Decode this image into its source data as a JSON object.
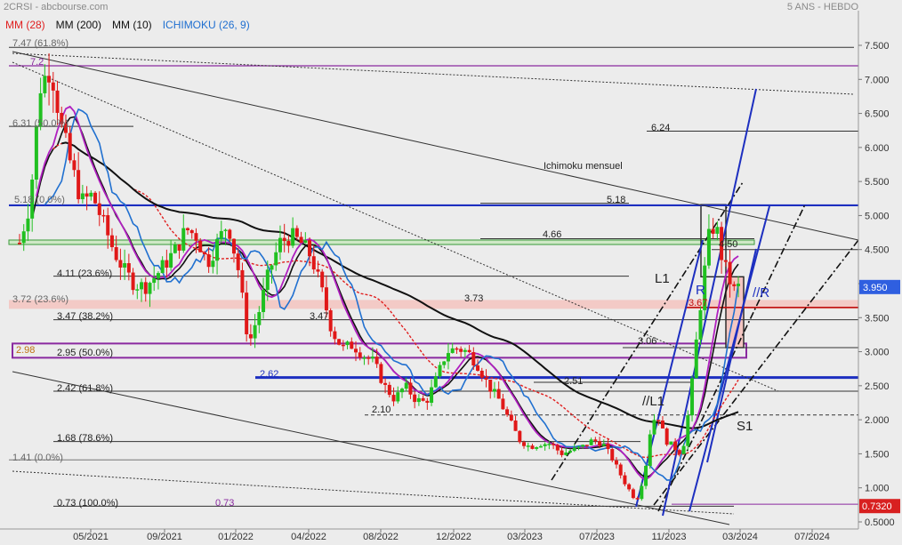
{
  "header": {
    "source": "2CRSI - abcbourse.com",
    "period": "5 ANS - HEBDO"
  },
  "legend": [
    {
      "label": "MM (28)",
      "color": "#e02020"
    },
    {
      "label": "MM (200)",
      "color": "#111111"
    },
    {
      "label": "MM (10)",
      "color": "#111111"
    },
    {
      "label": "ICHIMOKU (26, 9)",
      "color": "#1f6fd0"
    }
  ],
  "chart_data": {
    "type": "candlestick",
    "title": "",
    "y_ticks": [
      "7.500",
      "7.000",
      "6.500",
      "6.000",
      "5.500",
      "5.000",
      "4.500",
      "4.000",
      "3.500",
      "3.000",
      "2.500",
      "2.000",
      "1.500",
      "1.000",
      "0.5000"
    ],
    "x_ticks": [
      "05/2021",
      "09/2021",
      "01/2022",
      "04/2022",
      "08/2022",
      "12/2022",
      "03/2023",
      "07/2023",
      "11/2023",
      "03/2024",
      "07/2024"
    ],
    "ylim": [
      0.44,
      7.69
    ],
    "last_price": "3.950",
    "low_marker": "0.7320",
    "price_path": [
      [
        0,
        4.6
      ],
      [
        0.5,
        5.2
      ],
      [
        1,
        6.9
      ],
      [
        1.5,
        7.2
      ],
      [
        2,
        6.3
      ],
      [
        2.5,
        5.7
      ],
      [
        3,
        5.2
      ],
      [
        3.5,
        5.3
      ],
      [
        4,
        4.9
      ],
      [
        4.5,
        4.5
      ],
      [
        5,
        4.2
      ],
      [
        5.5,
        4.0
      ],
      [
        6,
        3.95
      ],
      [
        6.5,
        4.1
      ],
      [
        7,
        4.3
      ],
      [
        7.5,
        4.5
      ],
      [
        8,
        4.8
      ],
      [
        8.5,
        4.7
      ],
      [
        9,
        4.3
      ],
      [
        9.5,
        4.6
      ],
      [
        10,
        4.9
      ],
      [
        10.5,
        4.2
      ],
      [
        11,
        3.1
      ],
      [
        11.5,
        3.6
      ],
      [
        12,
        4.2
      ],
      [
        12.5,
        4.6
      ],
      [
        13,
        4.7
      ],
      [
        13.5,
        4.6
      ],
      [
        14,
        4.4
      ],
      [
        14.5,
        3.9
      ],
      [
        15,
        3.3
      ],
      [
        15.5,
        3.05
      ],
      [
        16,
        3.1
      ],
      [
        16.5,
        2.95
      ],
      [
        17,
        2.85
      ],
      [
        17.5,
        2.5
      ],
      [
        18,
        2.3
      ],
      [
        18.5,
        2.5
      ],
      [
        19,
        2.3
      ],
      [
        19.5,
        2.25
      ],
      [
        20,
        2.6
      ],
      [
        20.5,
        3.0
      ],
      [
        21,
        3.05
      ],
      [
        21.5,
        3.0
      ],
      [
        22,
        2.8
      ],
      [
        22.5,
        2.5
      ],
      [
        23,
        2.3
      ],
      [
        23.5,
        2.0
      ],
      [
        24,
        1.7
      ],
      [
        24.5,
        1.6
      ],
      [
        25,
        1.65
      ],
      [
        25.5,
        1.65
      ],
      [
        26,
        1.5
      ],
      [
        26.5,
        1.55
      ],
      [
        27,
        1.6
      ],
      [
        27.5,
        1.7
      ],
      [
        28,
        1.65
      ],
      [
        28.5,
        1.4
      ],
      [
        29,
        1.1
      ],
      [
        29.3,
        0.95
      ],
      [
        29.6,
        0.8
      ],
      [
        30,
        1.2
      ],
      [
        30.3,
        1.9
      ],
      [
        30.6,
        2.1
      ],
      [
        31,
        1.7
      ],
      [
        31.4,
        1.6
      ],
      [
        31.8,
        1.5
      ],
      [
        32.2,
        2.3
      ],
      [
        32.5,
        3.2
      ],
      [
        32.8,
        4.0
      ],
      [
        33.1,
        4.7
      ],
      [
        33.4,
        4.9
      ],
      [
        33.7,
        4.4
      ],
      [
        34.0,
        4.1
      ],
      [
        34.3,
        3.9
      ],
      [
        34.5,
        3.95
      ]
    ],
    "horizontal_lines": [
      {
        "label": "7.47  (61.8%)",
        "value": 7.47
      },
      {
        "label": "7.2",
        "value": 7.2
      },
      {
        "label": "6.31  (50.0%)",
        "value": 6.31
      },
      {
        "label": "6.24",
        "value": 6.24
      },
      {
        "label": "5.18",
        "value": 5.18
      },
      {
        "label": "5.18  (0.0%)",
        "value": 5.15
      },
      {
        "label": "4.66",
        "value": 4.66
      },
      {
        "label": "4.50",
        "value": 4.5
      },
      {
        "label": "4.11  (23.6%)",
        "value": 4.11
      },
      {
        "label": "3.73",
        "value": 3.73
      },
      {
        "label": "3.72  (23.6%)",
        "value": 3.72
      },
      {
        "label": "3.67",
        "value": 3.65
      },
      {
        "label": "3.47  (38.2%)",
        "value": 3.47
      },
      {
        "label": "3.47",
        "value": 3.47
      },
      {
        "label": "3.06",
        "value": 3.06
      },
      {
        "label": "2.98",
        "value": 2.98
      },
      {
        "label": "2.95  (50.0%)",
        "value": 2.95
      },
      {
        "label": "2.62",
        "value": 2.62
      },
      {
        "label": "2.51",
        "value": 2.55
      },
      {
        "label": "2.42  (61.8%)",
        "value": 2.42
      },
      {
        "label": "2.10",
        "value": 2.07
      },
      {
        "label": "1.68  (78.6%)",
        "value": 1.68
      },
      {
        "label": "1.41  (0.0%)",
        "value": 1.41
      },
      {
        "label": "0.73  (100.0%)",
        "value": 0.73
      },
      {
        "label": "0.73",
        "value": 0.73
      }
    ],
    "annotations": [
      "Ichimoku mensuel",
      "L1",
      "R",
      "//R",
      "//L1",
      "S1"
    ]
  }
}
